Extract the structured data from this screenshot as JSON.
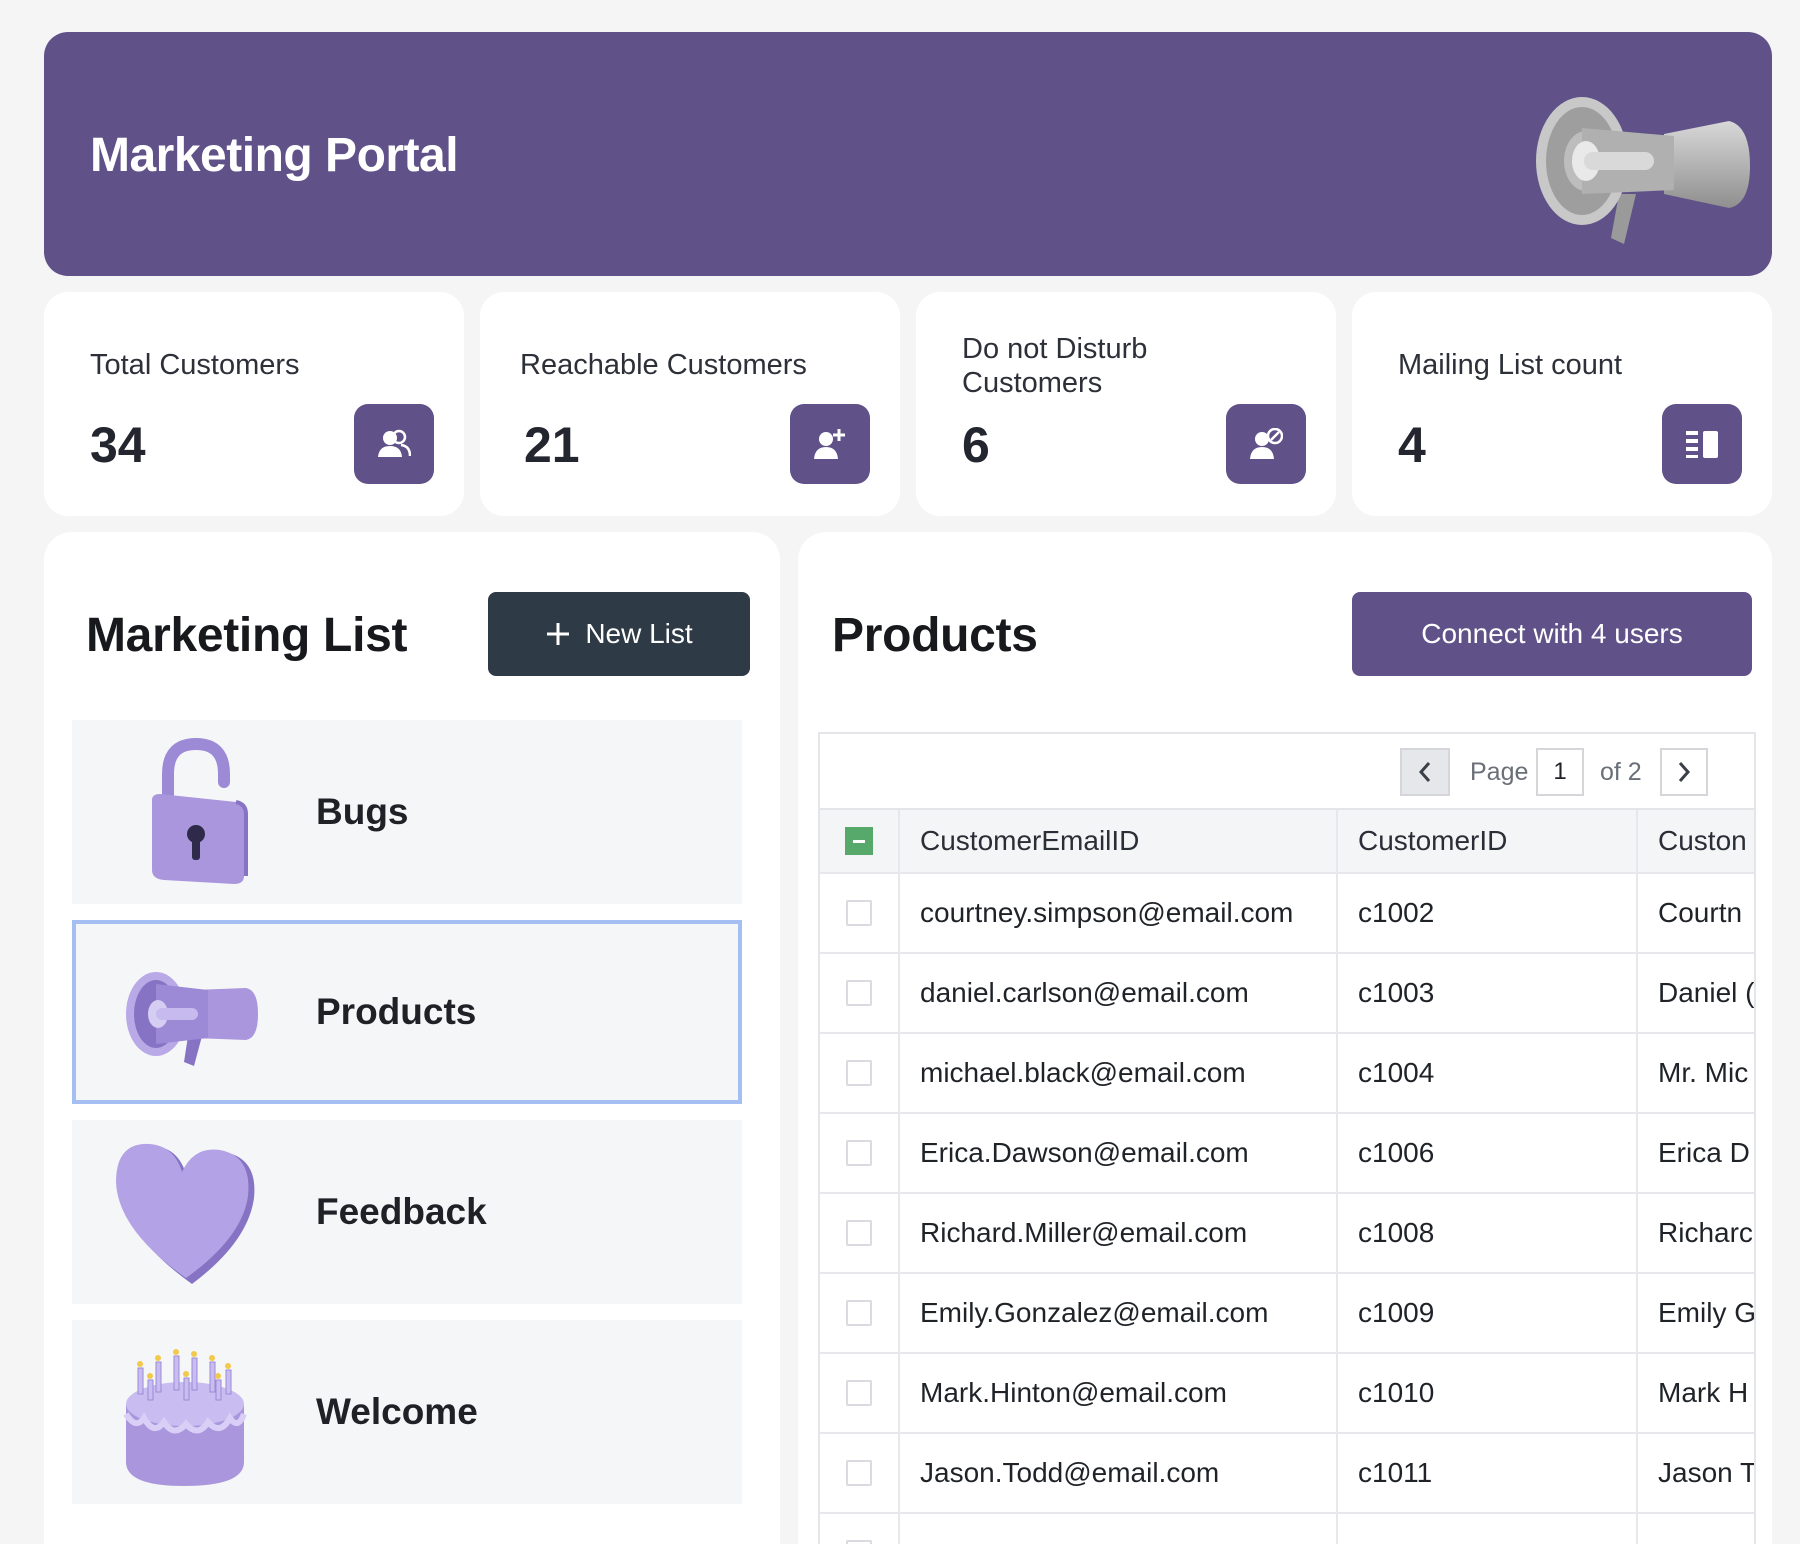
{
  "banner": {
    "title": "Marketing Portal",
    "art_icon": "megaphone-icon"
  },
  "stats": [
    {
      "label": "Total Customers",
      "value": "34",
      "icon": "users-icon"
    },
    {
      "label": "Reachable Customers",
      "value": "21",
      "icon": "user-add-icon"
    },
    {
      "label": "Do not Disturb Customers",
      "value": "6",
      "icon": "user-block-icon"
    },
    {
      "label": "Mailing List count",
      "value": "4",
      "icon": "list-icon"
    }
  ],
  "marketing": {
    "title": "Marketing List",
    "new_button": "New List",
    "items": [
      {
        "name": "Bugs",
        "icon": "padlock-icon"
      },
      {
        "name": "Products",
        "icon": "megaphone-icon",
        "selected": true
      },
      {
        "name": "Feedback",
        "icon": "heart-icon"
      },
      {
        "name": "Welcome",
        "icon": "cake-icon"
      }
    ]
  },
  "products": {
    "title": "Products",
    "connect_button": "Connect with 4 users",
    "pager": {
      "page_label": "Page",
      "page": "1",
      "of_label": "of 2"
    },
    "columns": [
      "CustomerEmailID",
      "CustomerID",
      "Custon"
    ],
    "rows": [
      {
        "email": "courtney.simpson@email.com",
        "id": "c1002",
        "name": "Courtn"
      },
      {
        "email": "daniel.carlson@email.com",
        "id": "c1003",
        "name": "Daniel ("
      },
      {
        "email": "michael.black@email.com",
        "id": "c1004",
        "name": "Mr. Mic"
      },
      {
        "email": "Erica.Dawson@email.com",
        "id": "c1006",
        "name": "Erica D"
      },
      {
        "email": "Richard.Miller@email.com",
        "id": "c1008",
        "name": "Richarc"
      },
      {
        "email": "Emily.Gonzalez@email.com",
        "id": "c1009",
        "name": "Emily G"
      },
      {
        "email": "Mark.Hinton@email.com",
        "id": "c1010",
        "name": "Mark H"
      },
      {
        "email": "Jason.Todd@email.com",
        "id": "c1011",
        "name": "Jason T"
      }
    ]
  },
  "colors": {
    "accent": "#605289",
    "dark_button": "#2e3a46",
    "selected_border": "#a5bff2"
  }
}
